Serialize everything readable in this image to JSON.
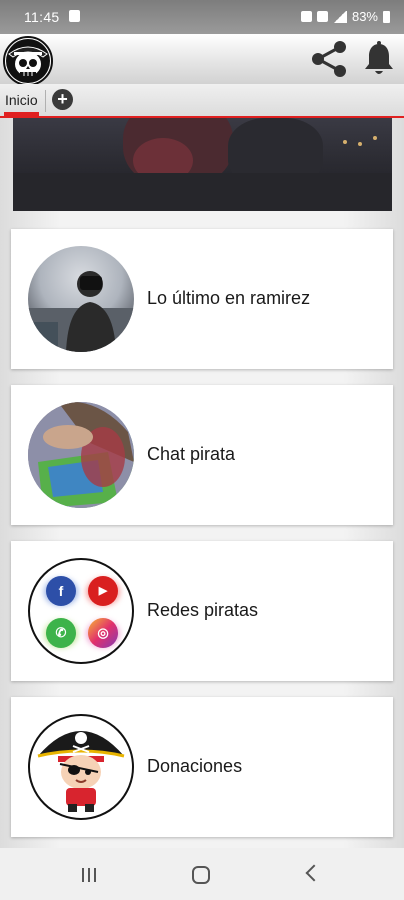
{
  "status_bar": {
    "time": "11:45",
    "battery": "83%"
  },
  "app_bar": {
    "logo_icon": "pirate-skull-logo",
    "share_icon": "share-icon",
    "notification_icon": "bell-icon"
  },
  "tabs": {
    "items": [
      {
        "label": "Inicio",
        "active": true
      }
    ],
    "add_icon": "plus-circle-icon"
  },
  "colors": {
    "accent": "#e02020",
    "status_bar": "#8a8a8a",
    "card": "#ffffff"
  },
  "banner": {
    "image": "dark-photo-banner"
  },
  "menu": [
    {
      "label": "Lo último en ramirez",
      "image": "person-with-camera-photo"
    },
    {
      "label": "Chat pirata",
      "image": "child-painting-photo"
    },
    {
      "label": "Redes piratas",
      "image": "social-network-icons"
    },
    {
      "label": "Donaciones",
      "image": "pirate-cartoon"
    }
  ],
  "nav": {
    "recents_icon": "recents-icon",
    "home_icon": "home-icon",
    "back_icon": "back-icon"
  }
}
